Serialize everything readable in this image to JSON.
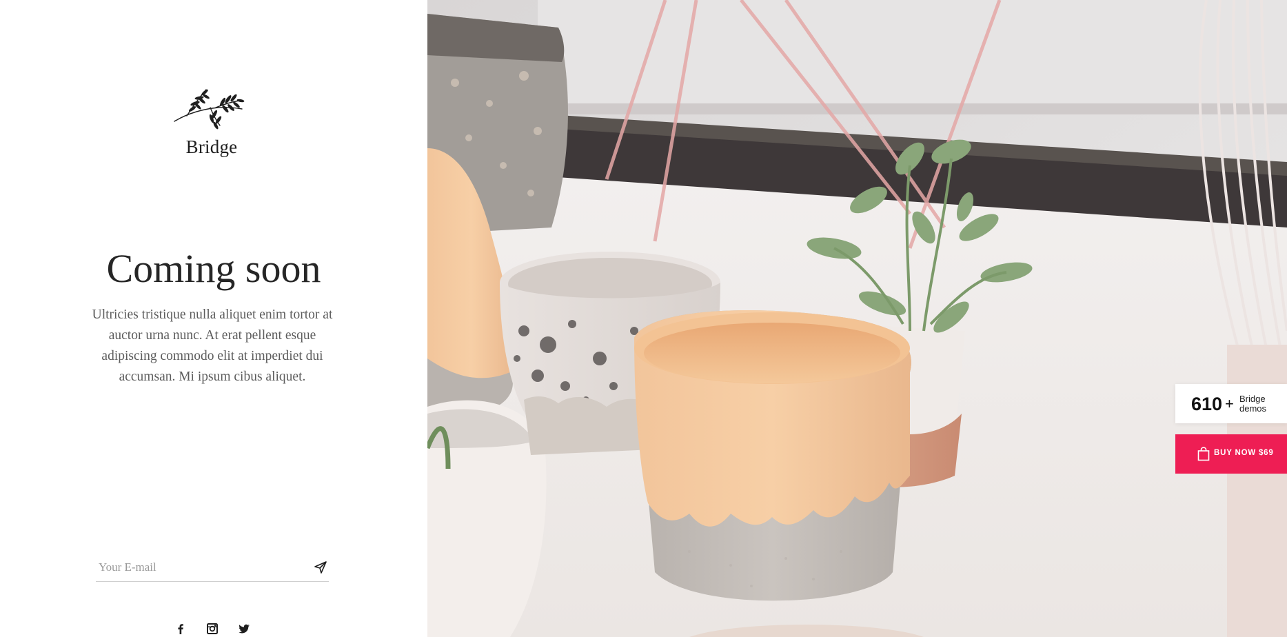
{
  "brand": {
    "name": "Bridge",
    "logo_icon": "leaf-branch-icon"
  },
  "hero": {
    "headline": "Coming soon",
    "description": "Ultricies tristique nulla aliquet enim tortor at auctor urna nunc. At erat pellent esque adipiscing commodo elit at imperdiet dui accumsan. Mi ipsum cibus aliquet.",
    "image_subject": "ceramic-pots-with-succulent"
  },
  "subscribe": {
    "placeholder": "Your E-mail",
    "value": "",
    "submit_icon": "paper-plane-icon"
  },
  "social": [
    {
      "name": "facebook",
      "icon": "facebook-icon"
    },
    {
      "name": "instagram",
      "icon": "instagram-icon"
    },
    {
      "name": "twitter",
      "icon": "twitter-icon"
    }
  ],
  "promo": {
    "demos_count": "610",
    "demos_plus": "+",
    "demos_label_line1": "Bridge",
    "demos_label_line2": "demos",
    "buy_label": "BUY NOW $69",
    "buy_icon": "shopping-bag-icon",
    "accent_color": "#ee1e54"
  }
}
